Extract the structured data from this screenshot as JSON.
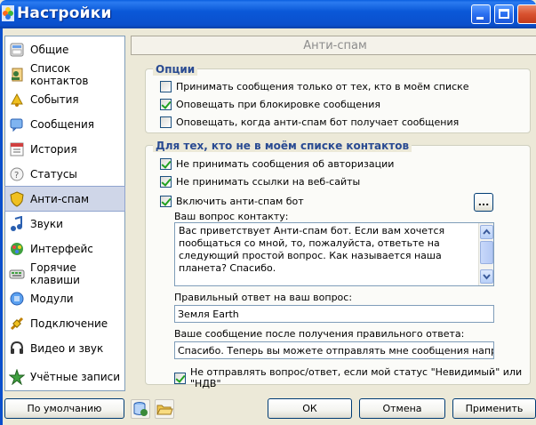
{
  "window": {
    "title": "Настройки"
  },
  "sidebar": {
    "items": [
      {
        "label": "Общие",
        "icon": "general-icon"
      },
      {
        "label": "Список контактов",
        "icon": "contact-list-icon"
      },
      {
        "label": "События",
        "icon": "events-icon"
      },
      {
        "label": "Сообщения",
        "icon": "messages-icon"
      },
      {
        "label": "История",
        "icon": "history-icon"
      },
      {
        "label": "Статусы",
        "icon": "statuses-icon"
      },
      {
        "label": "Анти-спам",
        "icon": "antispam-shield-icon"
      },
      {
        "label": "Звуки",
        "icon": "sounds-icon"
      },
      {
        "label": "Интерфейс",
        "icon": "interface-icon"
      },
      {
        "label": "Горячие клавиши",
        "icon": "hotkeys-icon"
      },
      {
        "label": "Модули",
        "icon": "modules-icon"
      },
      {
        "label": "Подключение",
        "icon": "connection-icon"
      },
      {
        "label": "Видео и звук",
        "icon": "video-sound-icon"
      },
      {
        "label": "Учётные записи",
        "icon": "accounts-icon"
      }
    ],
    "active_index": 6
  },
  "panel": {
    "title": "Анти-спам"
  },
  "options_group": {
    "title": "Опции",
    "checkboxes": [
      {
        "label": "Принимать сообщения только от тех, кто в моём списке",
        "checked": false
      },
      {
        "label": "Оповещать при блокировке сообщения",
        "checked": true
      },
      {
        "label": "Оповещать, когда анти-спам бот получает сообщения",
        "checked": false
      }
    ]
  },
  "unknown_group": {
    "title": "Для тех, кто не в моём списке контактов",
    "checkboxes": [
      {
        "label": "Не принимать сообщения об авторизации",
        "checked": true
      },
      {
        "label": "Не принимать ссылки на веб-сайты",
        "checked": true
      },
      {
        "label": "Включить анти-спам бот",
        "checked": true
      }
    ],
    "more_button_label": "...",
    "question_label": "Ваш вопрос контакту:",
    "question_text": "Вас приветствует Анти-спам бот. Если вам хочется пообщаться со мной, то, пожалуйста, ответьте на следующий простой вопрос. Как называется наша планета? Спасибо.\n\nHello. This is my Anti-spam control. If you would like to chat with me",
    "answer_label": "Правильный ответ на ваш вопрос:",
    "answer_value": "Земля Earth",
    "after_label": "Ваше сообщение после получения правильного ответа:",
    "after_value": "Спасибо. Теперь вы можете отправлять мне сообщения напрямую. Th",
    "invisible_checkbox": {
      "label": "Не отправлять вопрос/ответ, если мой статус \"Невидимый\" или \"НДВ\"",
      "checked": true
    }
  },
  "footer": {
    "default_button": "По умолчанию",
    "ok_button": "ОК",
    "cancel_button": "Отмена",
    "apply_button": "Применить"
  }
}
